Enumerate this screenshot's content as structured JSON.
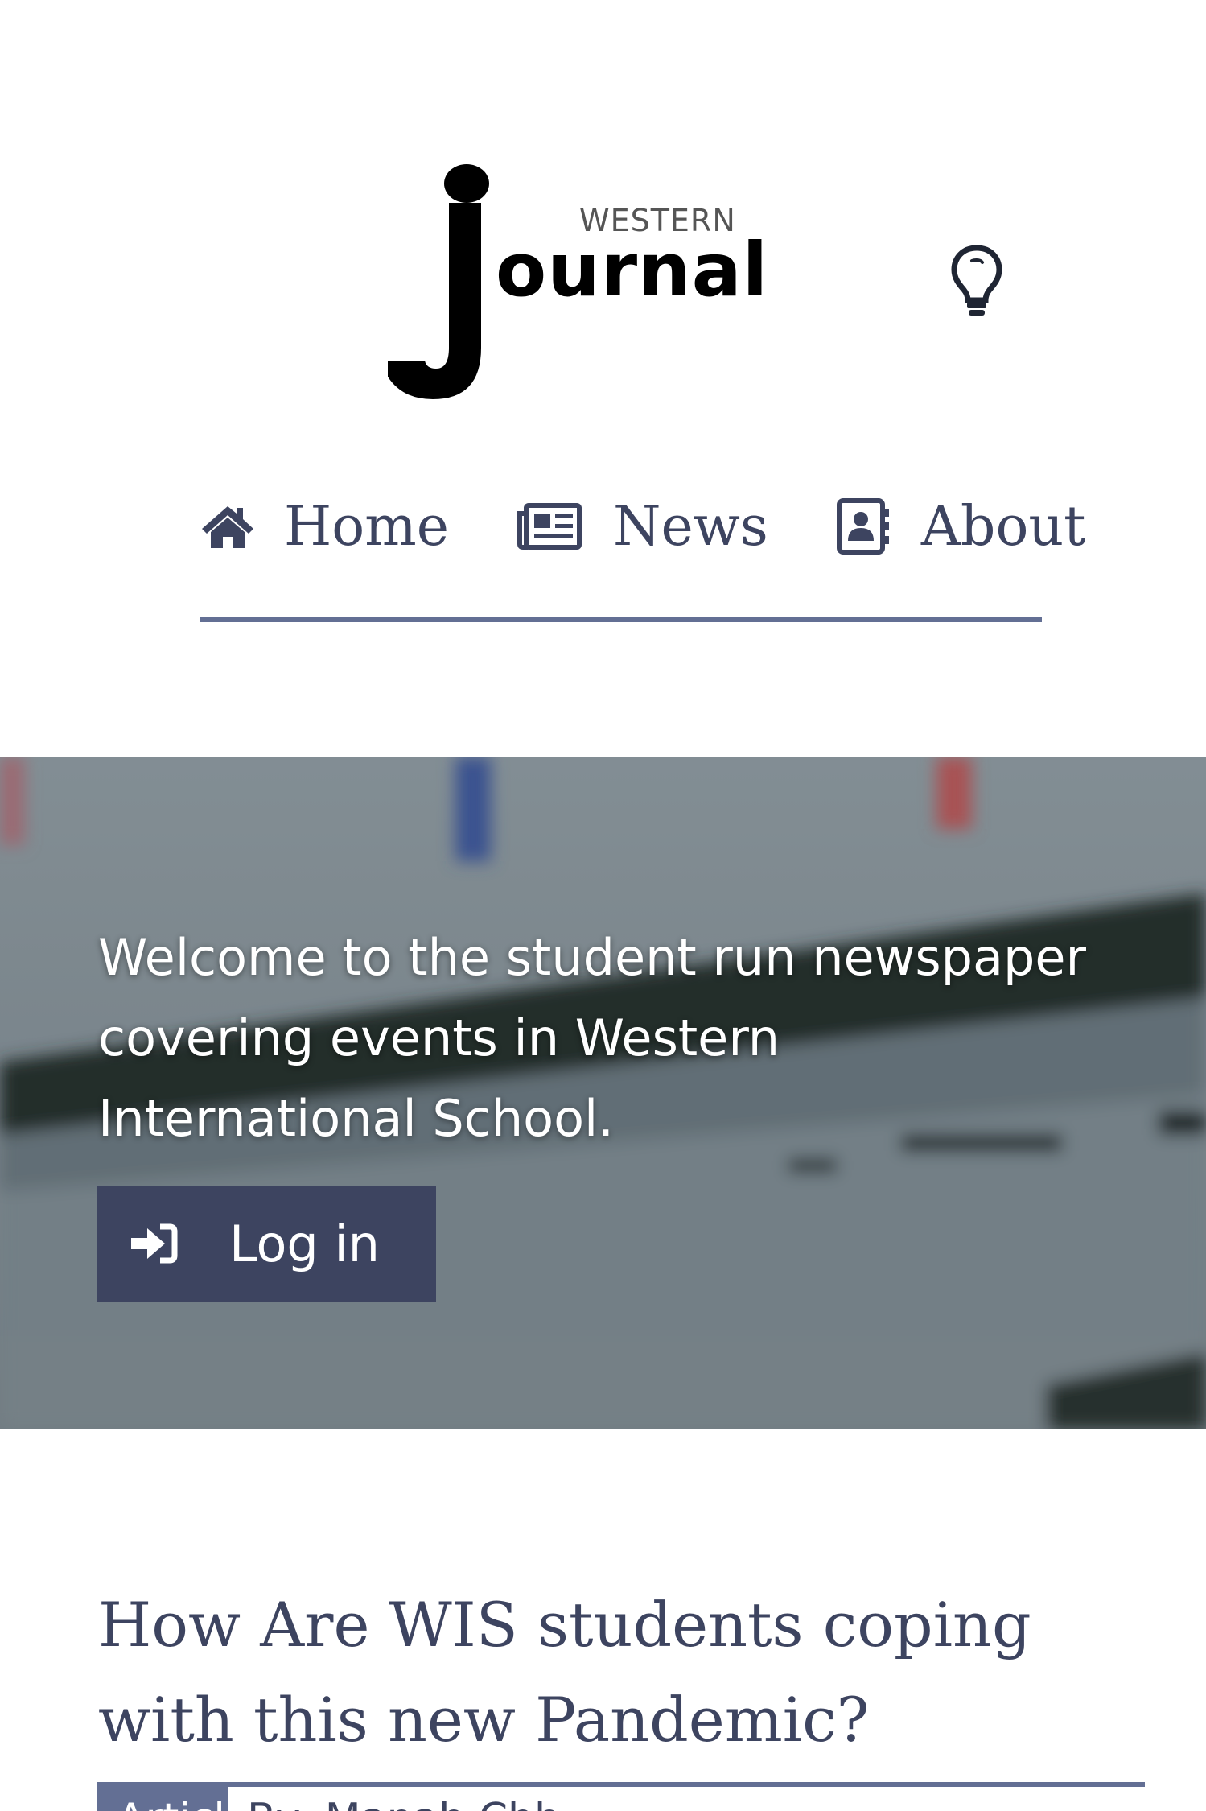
{
  "header": {
    "logo_small": "WESTERN",
    "logo_big": "ournal",
    "theme_toggle_icon": "lightbulb-icon"
  },
  "nav": {
    "items": [
      {
        "label": "Home",
        "icon": "home-icon"
      },
      {
        "label": "News",
        "icon": "newspaper-icon"
      },
      {
        "label": "About",
        "icon": "address-book-icon"
      }
    ]
  },
  "hero": {
    "text": "Welcome to the student run newspaper covering events in Western International School.",
    "login_label": "Log in",
    "login_icon": "sign-in-icon"
  },
  "article": {
    "title": "How Are WIS students coping with this new Pandemic?",
    "badge": "Article",
    "byline": "By: Manah Chh..."
  },
  "colors": {
    "accent": "#636f94",
    "text_dark": "#3d4460",
    "button_bg": "#3d4460"
  }
}
